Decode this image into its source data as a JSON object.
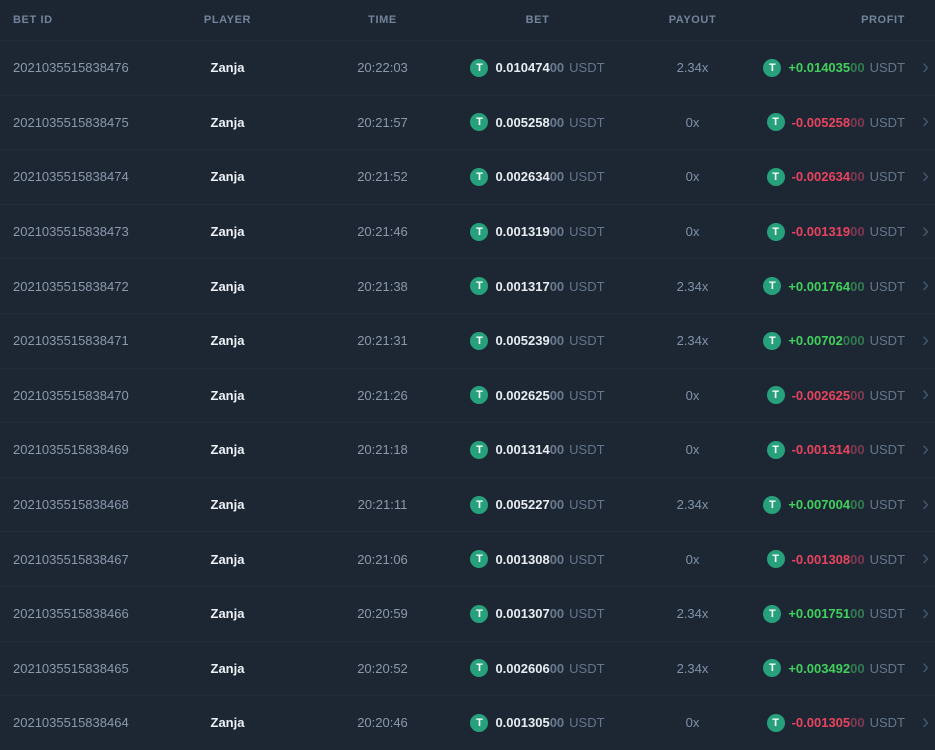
{
  "colors": {
    "background": "#1d2734",
    "header_text": "#73849a",
    "positive": "#41d05c",
    "negative": "#e8435e",
    "tether_green": "#26a17b"
  },
  "icons": {
    "currency": "tether-icon",
    "currency_glyph": "T",
    "row_chevron": "chevron-right-icon",
    "row_chevron_glyph": "›"
  },
  "table": {
    "currency": "USDT",
    "columns": [
      {
        "key": "bet_id",
        "label": "BET ID"
      },
      {
        "key": "player",
        "label": "PLAYER"
      },
      {
        "key": "time",
        "label": "TIME"
      },
      {
        "key": "bet",
        "label": "BET"
      },
      {
        "key": "payout",
        "label": "PAYOUT"
      },
      {
        "key": "profit",
        "label": "PROFIT"
      }
    ],
    "rows": [
      {
        "bet_id": "2021035515838476",
        "player": "Zanja",
        "time": "20:22:03",
        "bet_main": "0.010474",
        "bet_dim": "00",
        "payout": "2.34x",
        "profit_main": "+0.014035",
        "profit_dim": "00",
        "profit_positive": true
      },
      {
        "bet_id": "2021035515838475",
        "player": "Zanja",
        "time": "20:21:57",
        "bet_main": "0.005258",
        "bet_dim": "00",
        "payout": "0x",
        "profit_main": "-0.005258",
        "profit_dim": "00",
        "profit_positive": false
      },
      {
        "bet_id": "2021035515838474",
        "player": "Zanja",
        "time": "20:21:52",
        "bet_main": "0.002634",
        "bet_dim": "00",
        "payout": "0x",
        "profit_main": "-0.002634",
        "profit_dim": "00",
        "profit_positive": false
      },
      {
        "bet_id": "2021035515838473",
        "player": "Zanja",
        "time": "20:21:46",
        "bet_main": "0.001319",
        "bet_dim": "00",
        "payout": "0x",
        "profit_main": "-0.001319",
        "profit_dim": "00",
        "profit_positive": false
      },
      {
        "bet_id": "2021035515838472",
        "player": "Zanja",
        "time": "20:21:38",
        "bet_main": "0.001317",
        "bet_dim": "00",
        "payout": "2.34x",
        "profit_main": "+0.001764",
        "profit_dim": "00",
        "profit_positive": true
      },
      {
        "bet_id": "2021035515838471",
        "player": "Zanja",
        "time": "20:21:31",
        "bet_main": "0.005239",
        "bet_dim": "00",
        "payout": "2.34x",
        "profit_main": "+0.00702",
        "profit_dim": "000",
        "profit_positive": true
      },
      {
        "bet_id": "2021035515838470",
        "player": "Zanja",
        "time": "20:21:26",
        "bet_main": "0.002625",
        "bet_dim": "00",
        "payout": "0x",
        "profit_main": "-0.002625",
        "profit_dim": "00",
        "profit_positive": false
      },
      {
        "bet_id": "2021035515838469",
        "player": "Zanja",
        "time": "20:21:18",
        "bet_main": "0.001314",
        "bet_dim": "00",
        "payout": "0x",
        "profit_main": "-0.001314",
        "profit_dim": "00",
        "profit_positive": false
      },
      {
        "bet_id": "2021035515838468",
        "player": "Zanja",
        "time": "20:21:11",
        "bet_main": "0.005227",
        "bet_dim": "00",
        "payout": "2.34x",
        "profit_main": "+0.007004",
        "profit_dim": "00",
        "profit_positive": true
      },
      {
        "bet_id": "2021035515838467",
        "player": "Zanja",
        "time": "20:21:06",
        "bet_main": "0.001308",
        "bet_dim": "00",
        "payout": "0x",
        "profit_main": "-0.001308",
        "profit_dim": "00",
        "profit_positive": false
      },
      {
        "bet_id": "2021035515838466",
        "player": "Zanja",
        "time": "20:20:59",
        "bet_main": "0.001307",
        "bet_dim": "00",
        "payout": "2.34x",
        "profit_main": "+0.001751",
        "profit_dim": "00",
        "profit_positive": true
      },
      {
        "bet_id": "2021035515838465",
        "player": "Zanja",
        "time": "20:20:52",
        "bet_main": "0.002606",
        "bet_dim": "00",
        "payout": "2.34x",
        "profit_main": "+0.003492",
        "profit_dim": "00",
        "profit_positive": true
      },
      {
        "bet_id": "2021035515838464",
        "player": "Zanja",
        "time": "20:20:46",
        "bet_main": "0.001305",
        "bet_dim": "00",
        "payout": "0x",
        "profit_main": "-0.001305",
        "profit_dim": "00",
        "profit_positive": false
      }
    ]
  }
}
